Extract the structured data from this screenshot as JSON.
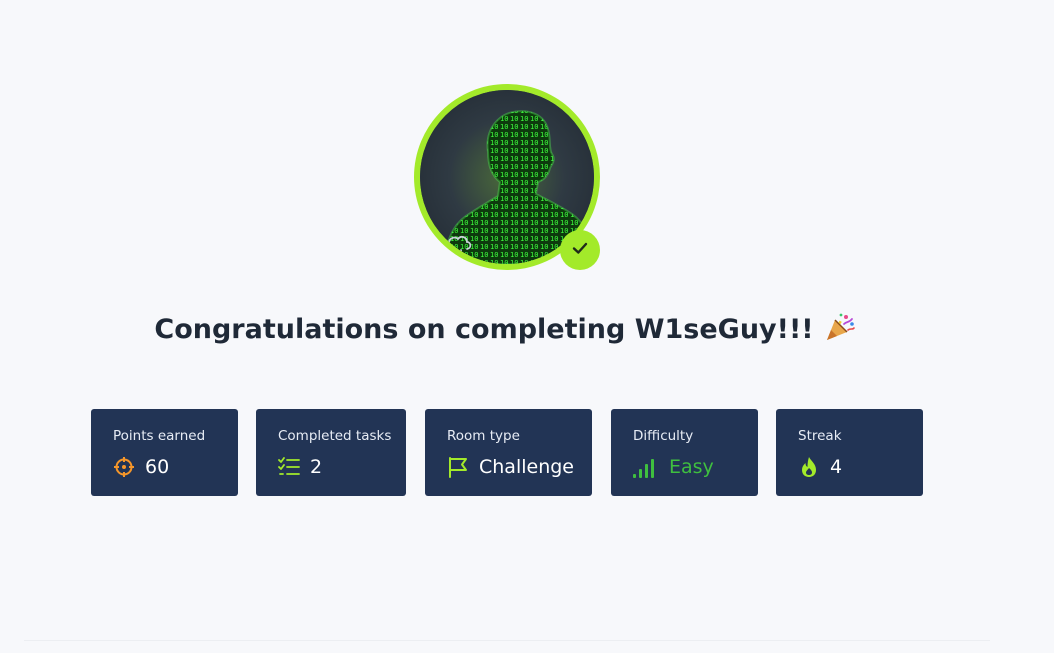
{
  "completion": {
    "title": "Congratulations on completing W1seGuy!!!",
    "celebration_icon": "party-popper-icon",
    "avatar_icon": "hacker-silhouette-avatar",
    "verified_icon": "checkmark-icon",
    "colors": {
      "accent": "#a3ea2a",
      "card_bg": "#223455",
      "page_bg": "#f7f8fb",
      "title": "#1f2937",
      "easy": "#3fbf3f",
      "points_icon": "#f5962a"
    }
  },
  "stats": [
    {
      "label": "Points earned",
      "value": "60",
      "icon": "target-icon"
    },
    {
      "label": "Completed tasks",
      "value": "2",
      "icon": "checklist-icon"
    },
    {
      "label": "Room type",
      "value": "Challenge",
      "icon": "flag-icon"
    },
    {
      "label": "Difficulty",
      "value": "Easy",
      "icon": "signal-bars-icon"
    },
    {
      "label": "Streak",
      "value": "4",
      "icon": "flame-icon"
    }
  ]
}
